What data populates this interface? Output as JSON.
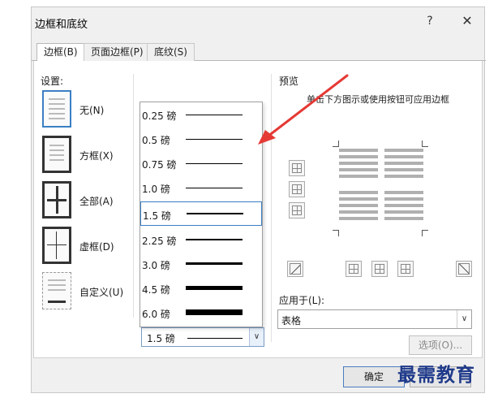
{
  "dialog": {
    "title": "边框和底纹",
    "help": "?",
    "close": "✕"
  },
  "tabs": [
    {
      "label": "边框(B)",
      "active": true
    },
    {
      "label": "页面边框(P)",
      "active": false
    },
    {
      "label": "底纹(S)",
      "active": false
    }
  ],
  "settings": {
    "label": "设置:",
    "items": [
      {
        "label": "无(N)",
        "selected": true
      },
      {
        "label": "方框(X)",
        "selected": false
      },
      {
        "label": "全部(A)",
        "selected": false
      },
      {
        "label": "虚框(D)",
        "selected": false
      },
      {
        "label": "自定义(U)",
        "selected": false
      }
    ]
  },
  "width_dropdown": {
    "options": [
      {
        "label": "0.25 磅",
        "weight": 0.25
      },
      {
        "label": "0.5 磅",
        "weight": 0.5
      },
      {
        "label": "0.75 磅",
        "weight": 0.75
      },
      {
        "label": "1.0 磅",
        "weight": 1.0
      },
      {
        "label": "1.5 磅",
        "weight": 1.5,
        "selected": true
      },
      {
        "label": "2.25 磅",
        "weight": 2.25
      },
      {
        "label": "3.0 磅",
        "weight": 3.0
      },
      {
        "label": "4.5 磅",
        "weight": 4.5
      },
      {
        "label": "6.0 磅",
        "weight": 6.0
      }
    ],
    "current": "1.5 磅",
    "arrow": "∨"
  },
  "preview": {
    "label": "预览",
    "hint": "单击下方图示或使用按钮可应用边框"
  },
  "apply_to": {
    "label": "应用于(L):",
    "value": "表格",
    "arrow": "∨"
  },
  "buttons": {
    "options": "选项(O)...",
    "ok": "确定"
  },
  "watermark": "最需教育",
  "colors": {
    "accent": "#3b7fc4",
    "arrow": "#e53935"
  }
}
